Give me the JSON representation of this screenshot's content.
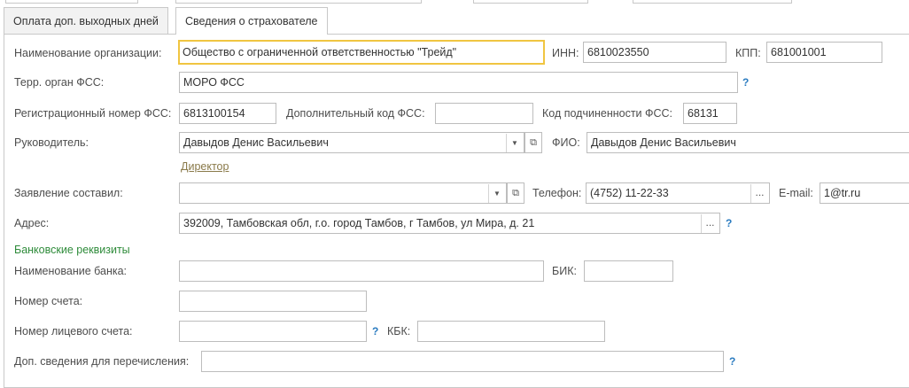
{
  "tabs": [
    {
      "label": "Оплата доп. выходных дней",
      "active": false
    },
    {
      "label": "Сведения о страхователе",
      "active": true
    }
  ],
  "form": {
    "org_name_label": "Наименование организации:",
    "org_name_value": "Общество с ограниченной ответственностью \"Трейд\"",
    "inn_label": "ИНН:",
    "inn_value": "6810023550",
    "kpp_label": "КПП:",
    "kpp_value": "681001001",
    "fss_label": "Терр. орган ФСС:",
    "fss_value": "МОРО ФСС",
    "reg_num_label": "Регистрационный номер ФСС:",
    "reg_num_value": "6813100154",
    "add_code_label": "Дополнительный код ФСС:",
    "add_code_value": "",
    "sub_code_label": "Код подчиненности ФСС:",
    "sub_code_value": "68131",
    "head_label": "Руководитель:",
    "head_value": "Давыдов Денис Васильевич",
    "fio_label": "ФИО:",
    "fio_value": "Давыдов Денис Васильевич",
    "position_link": "Директор",
    "statement_label": "Заявление составил:",
    "statement_value": "",
    "phone_label": "Телефон:",
    "phone_value": "(4752) 11-22-33",
    "email_label": "E-mail:",
    "email_value": "1@tr.ru",
    "address_label": "Адрес:",
    "address_value": "392009, Тамбовская обл, г.о. город Тамбов, г Тамбов, ул Мира, д. 21",
    "bank_section": "Банковские реквизиты",
    "bank_name_label": "Наименование банка:",
    "bank_name_value": "",
    "bik_label": "БИК:",
    "bik_value": "",
    "account_label": "Номер счета:",
    "account_value": "",
    "personal_account_label": "Номер лицевого счета:",
    "personal_account_value": "",
    "kbk_label": "КБК:",
    "kbk_value": "",
    "extra_label": "Доп. сведения для перечисления:",
    "extra_value": "",
    "help": "?"
  },
  "icons": {
    "dropdown": "▼",
    "open": "⧉",
    "select": "..."
  }
}
